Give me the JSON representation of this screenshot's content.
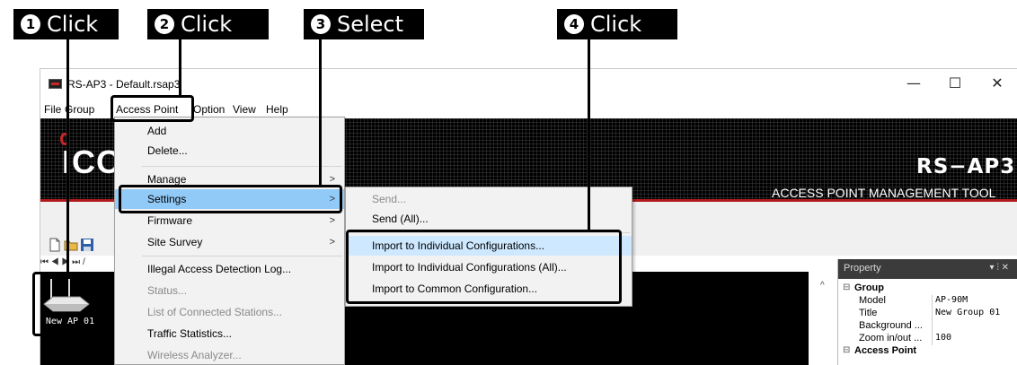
{
  "callouts": [
    {
      "num": "1",
      "label": "Click"
    },
    {
      "num": "2",
      "label": "Click"
    },
    {
      "num": "3",
      "label": "Select"
    },
    {
      "num": "4",
      "label": "Click"
    }
  ],
  "window": {
    "title": "RS-AP3 - Default.rsap3",
    "minimize": "—",
    "maximize": "☐",
    "close": "✕"
  },
  "menubar": [
    "File",
    "Group",
    "Access Point",
    "Option",
    "View",
    "Help"
  ],
  "banner": {
    "logo": "ICOM",
    "product": "RS−AP3",
    "subtitle": "ACCESS POINT MANAGEMENT TOOL"
  },
  "nav": "⏮ ◀ ▶ ⏭ /",
  "access_point_tile": {
    "label": "New AP 01"
  },
  "access_point_menu": [
    {
      "label": "Add",
      "enabled": true
    },
    {
      "label": "Delete...",
      "enabled": true
    },
    {
      "label": "Manage",
      "enabled": true,
      "submenu": true
    },
    {
      "label": "Settings",
      "enabled": true,
      "submenu": true,
      "selected": true
    },
    {
      "label": "Firmware",
      "enabled": true,
      "submenu": true
    },
    {
      "label": "Site Survey",
      "enabled": true,
      "submenu": true
    },
    {
      "label": "Illegal Access Detection Log...",
      "enabled": true
    },
    {
      "label": "Status...",
      "enabled": false
    },
    {
      "label": "List of Connected Stations...",
      "enabled": false
    },
    {
      "label": "Traffic Statistics...",
      "enabled": true
    },
    {
      "label": "Wireless Analyzer...",
      "enabled": false
    }
  ],
  "settings_submenu": [
    {
      "label": "Send...",
      "enabled": false
    },
    {
      "label": "Send (All)...",
      "enabled": true
    },
    {
      "label": "Import to Individual Configurations...",
      "enabled": true,
      "hover": true
    },
    {
      "label": "Import to Individual Configurations (All)...",
      "enabled": true
    },
    {
      "label": "Import to Common Configuration...",
      "enabled": true
    }
  ],
  "property_panel": {
    "title": "Property",
    "pins": "▾ ⫶ ✕",
    "rows": [
      {
        "key": "Group",
        "value": "",
        "group": true
      },
      {
        "key": "Model",
        "value": "AP-90M"
      },
      {
        "key": "Title",
        "value": "New Group 01"
      },
      {
        "key": "Background ...",
        "value": ""
      },
      {
        "key": "Zoom in/out ...",
        "value": "100"
      },
      {
        "key": "Access Point",
        "value": "",
        "group": true
      }
    ]
  },
  "colors": {
    "selection": "#91c9f7",
    "hover": "#cde8ff",
    "banner_red": "#b11a1a"
  }
}
